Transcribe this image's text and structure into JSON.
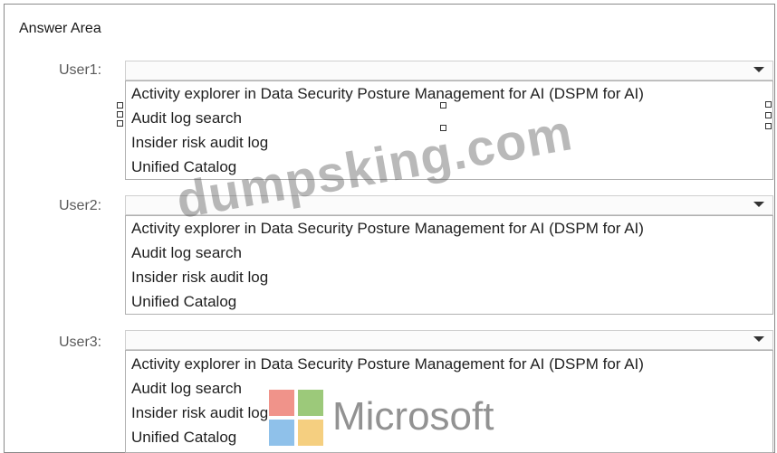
{
  "answer_area": {
    "title": "Answer Area"
  },
  "questions": [
    {
      "label": "User1:",
      "options": [
        "Activity explorer in Data Security Posture Management for AI (DSPM for AI)",
        "Audit log search",
        "Insider risk audit log",
        "Unified Catalog"
      ]
    },
    {
      "label": "User2:",
      "options": [
        "Activity explorer in Data Security Posture Management for AI (DSPM for AI)",
        "Audit log search",
        "Insider risk audit log",
        "Unified Catalog"
      ]
    },
    {
      "label": "User3:",
      "options": [
        "Activity explorer in Data Security Posture Management for AI (DSPM for AI)",
        "Audit log search",
        "Insider risk audit log",
        "Unified Catalog"
      ]
    }
  ],
  "watermark": {
    "text": "dumpsking.com"
  },
  "logo": {
    "text": "Microsoft",
    "colors": [
      "#f0938a",
      "#9cc97a",
      "#8fc1ea",
      "#f5cf80"
    ]
  }
}
